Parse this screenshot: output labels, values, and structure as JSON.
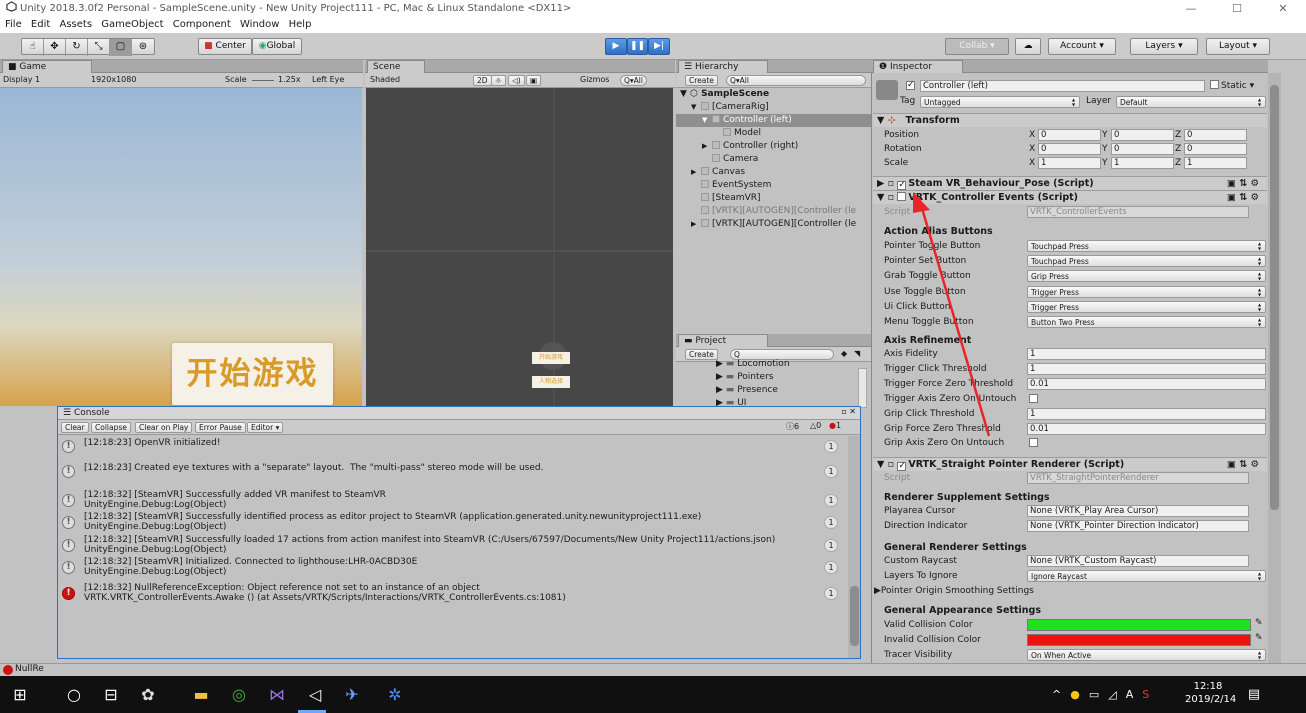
{
  "window": {
    "title": "Unity 2018.3.0f2 Personal - SampleScene.unity - New Unity Project111 - PC, Mac & Linux Standalone <DX11>",
    "controls": [
      "—",
      "☐",
      "✕"
    ]
  },
  "menu": [
    "File",
    "Edit",
    "Assets",
    "GameObject",
    "Component",
    "Window",
    "Help"
  ],
  "toolbar": {
    "tools": [
      "☝",
      "✥",
      "↻",
      "⤡",
      "▢",
      "⊛"
    ],
    "pivot": "Center",
    "space": "Global",
    "collab": "Collab ▾",
    "account": "Account",
    "layers": "Layers",
    "layout": "Layout"
  },
  "game": {
    "tab": "Game",
    "display": "Display 1",
    "resolution": "1920x1080",
    "scale_label": "Scale",
    "scale_value": "1.25x",
    "eye": "Left Eye",
    "start_button": "开始游戏"
  },
  "scene": {
    "tab": "Scene",
    "shading": "Shaded",
    "mode2d": "2D",
    "gizmos": "Gizmos",
    "search": "Q▾All",
    "label1": "开始游戏",
    "label2": "人物选择"
  },
  "hierarchy": {
    "tab": "Hierarchy",
    "create": "Create",
    "search": "Q▾All",
    "scene": "SampleScene",
    "items": [
      {
        "label": "[CameraRig]",
        "indent": 1,
        "arrow": "▼",
        "selected": false,
        "dim": false
      },
      {
        "label": "Controller (left)",
        "indent": 2,
        "arrow": "▼",
        "selected": true,
        "dim": false
      },
      {
        "label": "Model",
        "indent": 3,
        "arrow": "",
        "selected": false,
        "dim": false
      },
      {
        "label": "Controller (right)",
        "indent": 2,
        "arrow": "▶",
        "selected": false,
        "dim": false
      },
      {
        "label": "Camera",
        "indent": 2,
        "arrow": "",
        "selected": false,
        "dim": false
      },
      {
        "label": "Canvas",
        "indent": 1,
        "arrow": "▶",
        "selected": false,
        "dim": false
      },
      {
        "label": "EventSystem",
        "indent": 1,
        "arrow": "",
        "selected": false,
        "dim": false
      },
      {
        "label": "[SteamVR]",
        "indent": 1,
        "arrow": "",
        "selected": false,
        "dim": false
      },
      {
        "label": "[VRTK][AUTOGEN][Controller (le",
        "indent": 1,
        "arrow": "",
        "selected": false,
        "dim": true
      },
      {
        "label": "[VRTK][AUTOGEN][Controller (le",
        "indent": 1,
        "arrow": "▶",
        "selected": false,
        "dim": false
      }
    ]
  },
  "project": {
    "tab": "Project",
    "create": "Create",
    "search": "Q",
    "items": [
      "Locomotion",
      "Pointers",
      "Presence",
      "UI"
    ]
  },
  "inspector": {
    "tab": "Inspector",
    "object_name": "Controller (left)",
    "static": "Static",
    "tag_label": "Tag",
    "tag_value": "Untagged",
    "layer_label": "Layer",
    "layer_value": "Default",
    "transform": {
      "title": "Transform",
      "rows": [
        {
          "label": "Position",
          "x": "0",
          "y": "0",
          "z": "0"
        },
        {
          "label": "Rotation",
          "x": "0",
          "y": "0",
          "z": "0"
        },
        {
          "label": "Scale",
          "x": "1",
          "y": "1",
          "z": "1"
        }
      ]
    },
    "steam_pose": "Steam VR_Behaviour_Pose (Script)",
    "ctrl_events": {
      "title": "VRTK_Controller Events (Script)",
      "script_label": "Script",
      "script_value": "VRTK_ControllerEvents",
      "alias_header": "Action Alias Buttons",
      "alias_rows": [
        {
          "label": "Pointer Toggle Button",
          "value": "Touchpad Press"
        },
        {
          "label": "Pointer Set Button",
          "value": "Touchpad Press"
        },
        {
          "label": "Grab Toggle Button",
          "value": "Grip Press"
        },
        {
          "label": "Use Toggle Button",
          "value": "Trigger Press"
        },
        {
          "label": "Ui Click Button",
          "value": "Trigger Press"
        },
        {
          "label": "Menu Toggle Button",
          "value": "Button Two Press"
        }
      ],
      "axis_header": "Axis Refinement",
      "axis_rows": [
        {
          "label": "Axis Fidelity",
          "value": "1",
          "kind": "field"
        },
        {
          "label": "Trigger Click Threshold",
          "value": "1",
          "kind": "field"
        },
        {
          "label": "Trigger Force Zero Threshold",
          "value": "0.01",
          "kind": "field"
        },
        {
          "label": "Trigger Axis Zero On Untouch",
          "value": "",
          "kind": "check"
        },
        {
          "label": "Grip Click Threshold",
          "value": "1",
          "kind": "field"
        },
        {
          "label": "Grip Force Zero Threshold",
          "value": "0.01",
          "kind": "field"
        },
        {
          "label": "Grip Axis Zero On Untouch",
          "value": "",
          "kind": "check"
        }
      ]
    },
    "straight": {
      "title": "VRTK_Straight Pointer Renderer (Script)",
      "script_label": "Script",
      "script_value": "VRTK_StraightPointerRenderer",
      "supp_header": "Renderer Supplement Settings",
      "playarea_label": "Playarea Cursor",
      "playarea_value": "None (VRTK_Play Area Cursor)",
      "direction_label": "Direction Indicator",
      "direction_value": "None (VRTK_Pointer Direction Indicator)",
      "general_header": "General Renderer Settings",
      "raycast_label": "Custom Raycast",
      "raycast_value": "None (VRTK_Custom Raycast)",
      "ignore_label": "Layers To Ignore",
      "ignore_value": "Ignore Raycast",
      "smoothing": "Pointer Origin Smoothing Settings",
      "appearance_header": "General Appearance Settings",
      "valid_label": "Valid Collision Color",
      "valid_color": "#1ee01e",
      "invalid_label": "Invalid Collision Color",
      "invalid_color": "#ef1010",
      "tracer_label": "Tracer Visibility",
      "tracer_value": "On When Active"
    }
  },
  "console": {
    "tab": "Console",
    "buttons": [
      "Clear",
      "Collapse",
      "Clear on Play",
      "Error Pause",
      "Editor ▾"
    ],
    "counts": {
      "info": "6",
      "warn": "0",
      "error": "1"
    },
    "entries": [
      {
        "type": "info",
        "line1": "[12:18:23] OpenVR initialized!",
        "line2": "",
        "count": "1"
      },
      {
        "type": "info",
        "line1": "[12:18:23] Created eye textures with a \"separate\" layout.  The \"multi-pass\" stereo mode will be used.",
        "line2": "",
        "count": "1"
      },
      {
        "type": "info",
        "line1": "[12:18:32] [SteamVR] Successfully added VR manifest to SteamVR",
        "line2": "UnityEngine.Debug:Log(Object)",
        "count": "1"
      },
      {
        "type": "info",
        "line1": "[12:18:32] [SteamVR] Successfully identified process as editor project to SteamVR (application.generated.unity.newunityproject111.exe)",
        "line2": "UnityEngine.Debug:Log(Object)",
        "count": "1"
      },
      {
        "type": "info",
        "line1": "[12:18:32] [SteamVR] Successfully loaded 17 actions from action manifest into SteamVR (C:/Users/67597/Documents/New Unity Project111/actions.json)",
        "line2": "UnityEngine.Debug:Log(Object)",
        "count": "1"
      },
      {
        "type": "info",
        "line1": "[12:18:32] [SteamVR] Initialized. Connected to lighthouse:LHR-0ACBD30E",
        "line2": "UnityEngine.Debug:Log(Object)",
        "count": "1"
      },
      {
        "type": "error",
        "line1": "[12:18:32] NullReferenceException: Object reference not set to an instance of an object",
        "line2": "VRTK.VRTK_ControllerEvents.Awake () (at Assets/VRTK/Scripts/Interactions/VRTK_ControllerEvents.cs:1081)",
        "count": "1"
      }
    ]
  },
  "statusbar": {
    "text": "NullRe"
  },
  "taskbar": {
    "time": "12:18",
    "date": "2019/2/14",
    "tray": [
      "^",
      "●",
      "▭",
      "◿",
      "A"
    ]
  }
}
